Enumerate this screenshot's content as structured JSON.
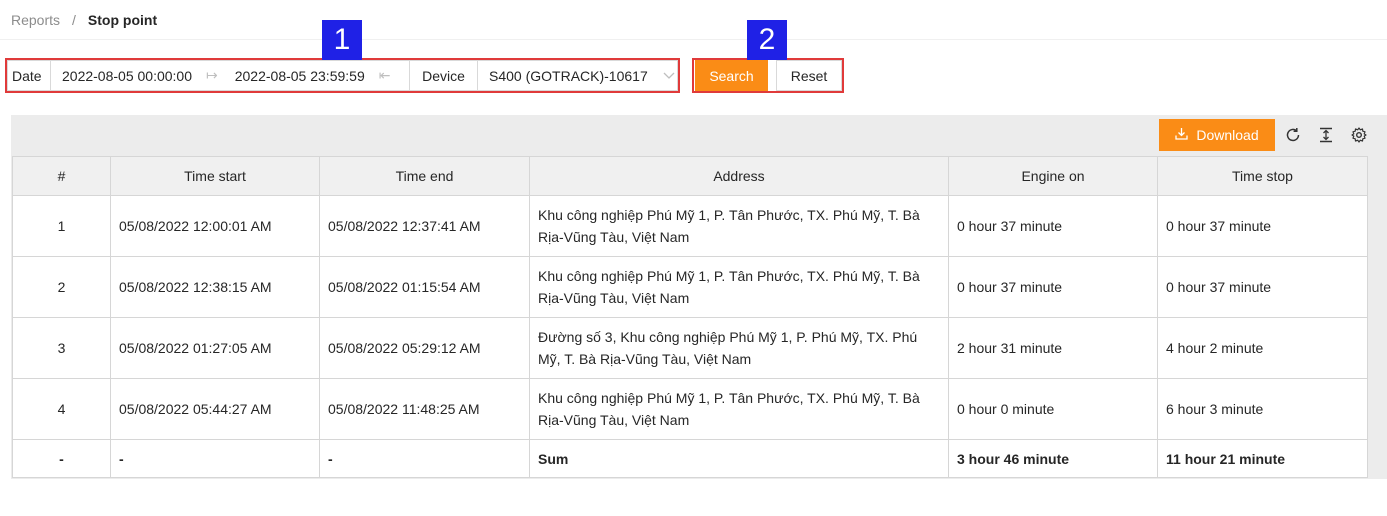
{
  "breadcrumb": {
    "parent": "Reports",
    "separator": "/",
    "current": "Stop point"
  },
  "filter": {
    "date_label": "Date",
    "date_from": "2022-08-05 00:00:00",
    "date_to": "2022-08-05 23:59:59",
    "device_label": "Device",
    "device_value": "S400 (GOTRACK)-10617"
  },
  "markers": {
    "one": "1",
    "two": "2"
  },
  "actions": {
    "search_label": "Search",
    "reset_label": "Reset",
    "download_label": "Download"
  },
  "toolbar_icons": [
    "reload-icon",
    "column-height-icon",
    "setting-icon"
  ],
  "colors": {
    "accent": "#fa8c16",
    "marker": "#1f21e6",
    "highlight": "#e03a3a"
  },
  "table": {
    "columns": [
      "#",
      "Time start",
      "Time end",
      "Address",
      "Engine on",
      "Time stop"
    ],
    "rows": [
      {
        "idx": "1",
        "start": "05/08/2022 12:00:01 AM",
        "end": "05/08/2022 12:37:41 AM",
        "address": "Khu công nghiệp Phú Mỹ 1, P. Tân Phước, TX. Phú Mỹ, T. Bà Rịa-Vũng Tàu, Việt Nam",
        "engine_on": "0 hour 37 minute",
        "time_stop": "0 hour 37 minute"
      },
      {
        "idx": "2",
        "start": "05/08/2022 12:38:15 AM",
        "end": "05/08/2022 01:15:54 AM",
        "address": "Khu công nghiệp Phú Mỹ 1, P. Tân Phước, TX. Phú Mỹ, T. Bà Rịa-Vũng Tàu, Việt Nam",
        "engine_on": "0 hour 37 minute",
        "time_stop": "0 hour 37 minute"
      },
      {
        "idx": "3",
        "start": "05/08/2022 01:27:05 AM",
        "end": "05/08/2022 05:29:12 AM",
        "address": "Đường số 3, Khu công nghiệp Phú Mỹ 1, P. Phú Mỹ, TX. Phú Mỹ, T. Bà Rịa-Vũng Tàu, Việt Nam",
        "engine_on": "2 hour 31 minute",
        "time_stop": "4 hour 2 minute"
      },
      {
        "idx": "4",
        "start": "05/08/2022 05:44:27 AM",
        "end": "05/08/2022 11:48:25 AM",
        "address": "Khu công nghiệp Phú Mỹ 1, P. Tân Phước, TX. Phú Mỹ, T. Bà Rịa-Vũng Tàu, Việt Nam",
        "engine_on": "0 hour 0 minute",
        "time_stop": "6 hour 3 minute"
      }
    ],
    "summary": {
      "idx": "-",
      "start": "-",
      "end": "-",
      "address": "Sum",
      "engine_on": "3 hour 46 minute",
      "time_stop": "11 hour 21 minute"
    }
  }
}
